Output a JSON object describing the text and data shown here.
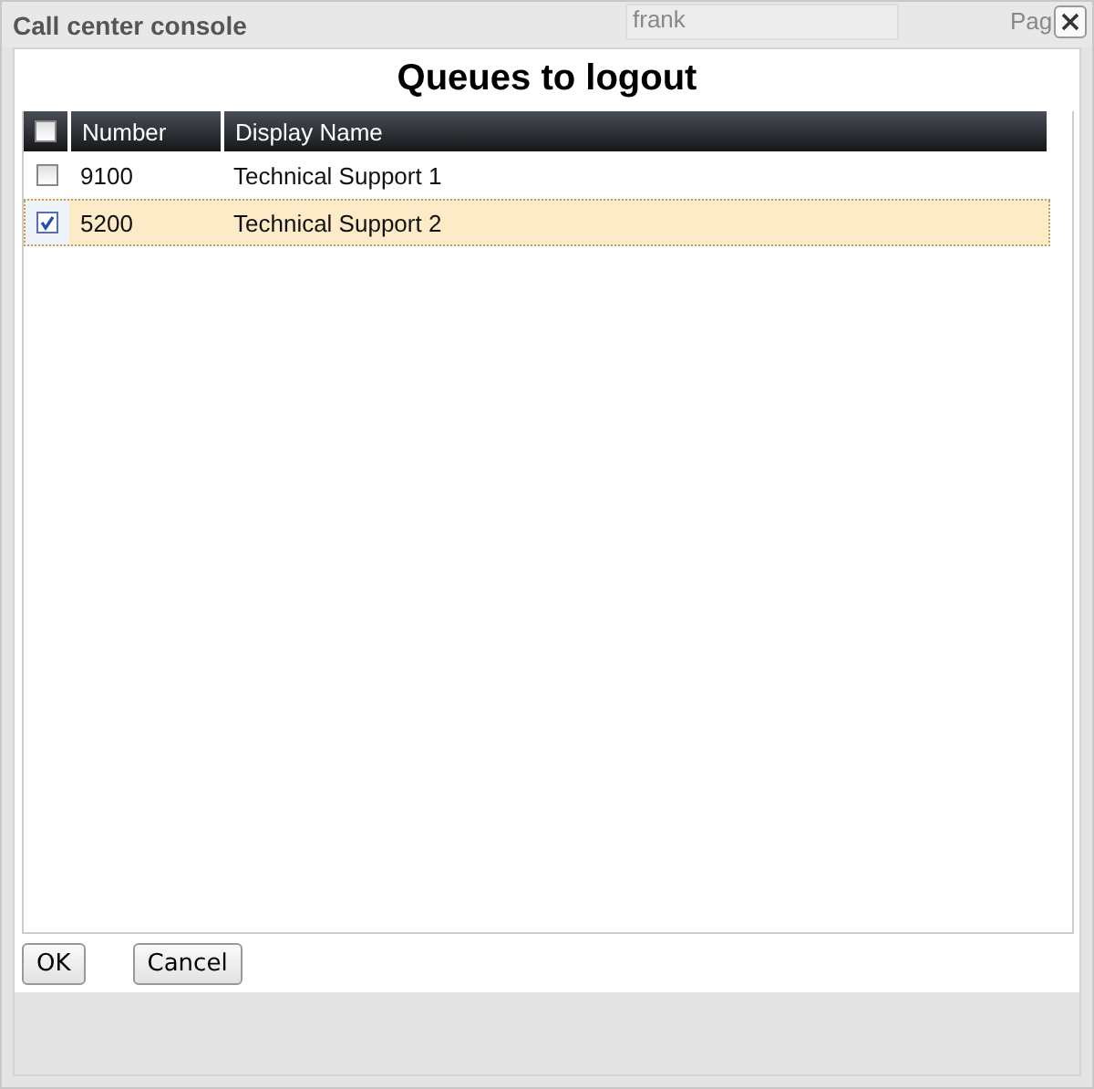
{
  "window": {
    "title": "Call center console",
    "background_search": "frank",
    "background_link": "Pag"
  },
  "heading": "Queues to logout",
  "table": {
    "all_checked": false,
    "columns": [
      "Number",
      "Display Name"
    ],
    "rows": [
      {
        "number": "9100",
        "name": "Technical Support 1",
        "checked": false,
        "selected": false
      },
      {
        "number": "5200",
        "name": "Technical Support 2",
        "checked": true,
        "selected": true
      }
    ]
  },
  "buttons": [
    "OK",
    "Cancel"
  ]
}
